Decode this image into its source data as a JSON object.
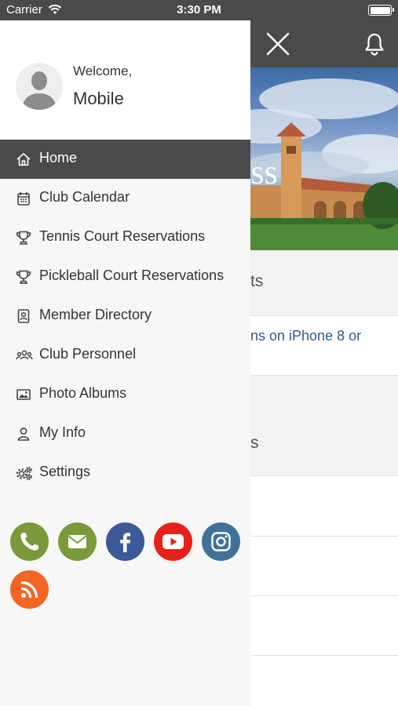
{
  "status_bar": {
    "carrier": "Carrier",
    "time": "3:30 PM"
  },
  "profile": {
    "welcome": "Welcome,",
    "name": "Mobile"
  },
  "nav": {
    "items": [
      {
        "label": "Home",
        "icon": "home-icon",
        "active": true
      },
      {
        "label": "Club Calendar",
        "icon": "calendar-icon",
        "active": false
      },
      {
        "label": "Tennis Court Reservations",
        "icon": "trophy-icon",
        "active": false
      },
      {
        "label": "Pickleball Court Reservations",
        "icon": "trophy-icon",
        "active": false
      },
      {
        "label": "Member Directory",
        "icon": "contact-card-icon",
        "active": false
      },
      {
        "label": "Club Personnel",
        "icon": "people-icon",
        "active": false
      },
      {
        "label": "Photo Albums",
        "icon": "image-icon",
        "active": false
      },
      {
        "label": "My Info",
        "icon": "user-icon",
        "active": false
      },
      {
        "label": "Settings",
        "icon": "gears-icon",
        "active": false
      }
    ]
  },
  "social": {
    "buttons": [
      {
        "name": "phone",
        "icon": "phone-icon",
        "color": "#7a9a3a"
      },
      {
        "name": "email",
        "icon": "envelope-icon",
        "color": "#7a9a3a"
      },
      {
        "name": "facebook",
        "icon": "facebook-icon",
        "color": "#3b5a9a"
      },
      {
        "name": "youtube",
        "icon": "youtube-icon",
        "color": "#e62117"
      },
      {
        "name": "instagram",
        "icon": "instagram-icon",
        "color": "#3f729b"
      },
      {
        "name": "rss",
        "icon": "rss-icon",
        "color": "#f26522"
      }
    ]
  },
  "main": {
    "hero_text": "ess",
    "section1_title": "ts",
    "section1_link": "ns on iPhone 8 or",
    "section2_title": "s"
  },
  "colors": {
    "header_bg": "#4a4a4a",
    "drawer_bg": "#f7f7f7",
    "active_item_bg": "#4a4a4a"
  }
}
